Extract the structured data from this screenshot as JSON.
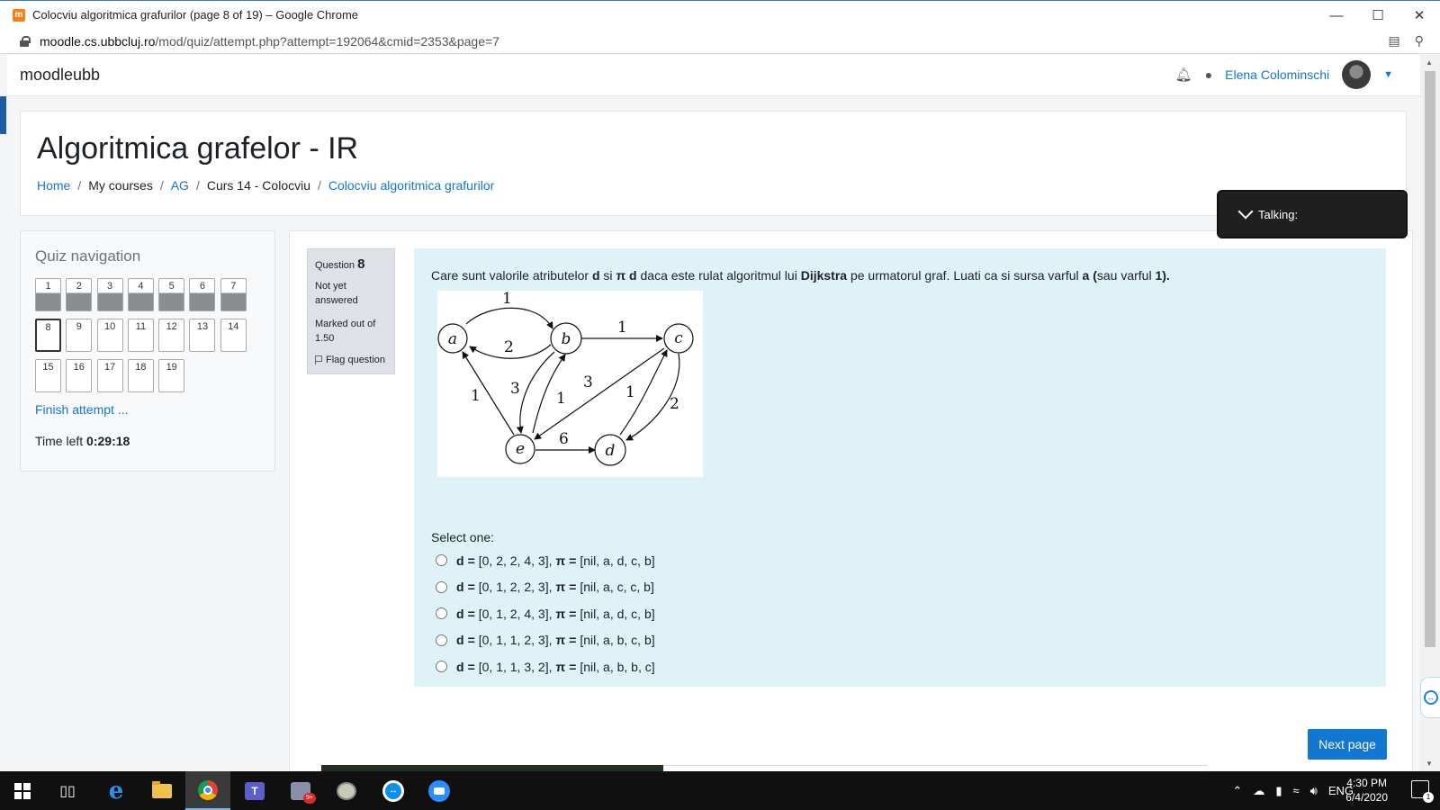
{
  "browser": {
    "tab_title": "Colocviu algoritmica grafurilor (page 8 of 19) – Google Chrome",
    "favicon_text": "m",
    "url_host": "moodle.cs.ubbcluj.ro",
    "url_path": "/mod/quiz/attempt.php?attempt=192064&cmid=2353&page=7",
    "window_controls": [
      "minimize-icon",
      "maximize-icon",
      "close-icon"
    ]
  },
  "navbar": {
    "brand": "moodleubb",
    "user_name": "Elena Colominschi"
  },
  "header": {
    "title": "Algoritmica grafelor - IR",
    "breadcrumb": [
      {
        "label": "Home",
        "link": true
      },
      {
        "label": "My courses",
        "link": false
      },
      {
        "label": "AG",
        "link": true
      },
      {
        "label": "Curs 14 - Colocviu",
        "link": false
      },
      {
        "label": "Colocviu algoritmica grafurilor",
        "link": true
      }
    ]
  },
  "overlay": {
    "label": "Talking:"
  },
  "quiz_nav": {
    "title": "Quiz navigation",
    "buttons": [
      {
        "label": "1",
        "state": "answered"
      },
      {
        "label": "2",
        "state": "answered"
      },
      {
        "label": "3",
        "state": "answered"
      },
      {
        "label": "4",
        "state": "answered"
      },
      {
        "label": "5",
        "state": "answered"
      },
      {
        "label": "6",
        "state": "answered"
      },
      {
        "label": "7",
        "state": "answered"
      },
      {
        "label": "8",
        "state": "current"
      },
      {
        "label": "9",
        "state": "unanswered"
      },
      {
        "label": "10",
        "state": "unanswered"
      },
      {
        "label": "11",
        "state": "unanswered"
      },
      {
        "label": "12",
        "state": "unanswered"
      },
      {
        "label": "13",
        "state": "unanswered"
      },
      {
        "label": "14",
        "state": "unanswered"
      },
      {
        "label": "15",
        "state": "unanswered"
      },
      {
        "label": "16",
        "state": "unanswered"
      },
      {
        "label": "17",
        "state": "unanswered"
      },
      {
        "label": "18",
        "state": "unanswered"
      },
      {
        "label": "19",
        "state": "unanswered"
      }
    ],
    "finish_label": "Finish attempt ...",
    "time_left_label": "Time left",
    "time_left_value": "0:29:18"
  },
  "question": {
    "number_label": "Question",
    "number": "8",
    "state": "Not yet answered",
    "grade": "Marked out of 1.50",
    "flag_label": "Flag question",
    "text_parts": [
      {
        "t": "Care sunt valorile atributelor ",
        "b": false
      },
      {
        "t": "d",
        "b": true
      },
      {
        "t": " si ",
        "b": false
      },
      {
        "t": "π  d",
        "b": true
      },
      {
        "t": " daca este rulat algoritmul lui ",
        "b": false
      },
      {
        "t": "Dijkstra",
        "b": true
      },
      {
        "t": " pe urmatorul graf. Luati ca si sursa varful ",
        "b": false
      },
      {
        "t": "a (",
        "b": true
      },
      {
        "t": "sau varful ",
        "b": false
      },
      {
        "t": "1).",
        "b": true
      }
    ],
    "graph": {
      "nodes": [
        "a",
        "b",
        "c",
        "d",
        "e"
      ],
      "edges": [
        {
          "from": "a",
          "to": "b",
          "w": "1"
        },
        {
          "from": "b",
          "to": "a",
          "w": "2"
        },
        {
          "from": "b",
          "to": "c",
          "w": "1"
        },
        {
          "from": "e",
          "to": "a",
          "w": "1"
        },
        {
          "from": "b",
          "to": "e",
          "w": "3"
        },
        {
          "from": "e",
          "to": "b",
          "w": "1"
        },
        {
          "from": "c",
          "to": "e",
          "w": "3"
        },
        {
          "from": "d",
          "to": "c",
          "w": "1"
        },
        {
          "from": "c",
          "to": "d",
          "w": "2"
        },
        {
          "from": "e",
          "to": "d",
          "w": "6"
        }
      ]
    },
    "select_one": "Select one:",
    "options": [
      {
        "d_label": "d",
        "eq": "=",
        "d": "[0, 2, 2, 4, 3],",
        "pi_label": "π",
        "pi": "[nil, a, d, c, b]"
      },
      {
        "d_label": "d",
        "eq": "=",
        "d": "[0, 1, 2, 2, 3],",
        "pi_label": "π",
        "pi": "[nil, a, c, c, b]"
      },
      {
        "d_label": "d",
        "eq": "=",
        "d": "[0, 1, 2, 4, 3],",
        "pi_label": "π",
        "pi": "[nil, a, d, c, b]"
      },
      {
        "d_label": "d",
        "eq": "=",
        "d": "[0, 1, 1, 2, 3],",
        "pi_label": "π",
        "pi": "[nil, a, b, c, b]"
      },
      {
        "d_label": "d",
        "eq": "=",
        "d": "[0, 1, 1, 3, 2],",
        "pi_label": "π",
        "pi": "[nil, a, b, b, c]"
      }
    ],
    "next_label": "Next page"
  },
  "taskbar": {
    "lang": "ENG",
    "time": "4:30 PM",
    "date": "6/4/2020",
    "notification_count": "1",
    "mail_badge": "9+"
  },
  "colors": {
    "link": "#1177d1",
    "formulation_bg": "#def2f8",
    "next_button": "#1177d1"
  }
}
